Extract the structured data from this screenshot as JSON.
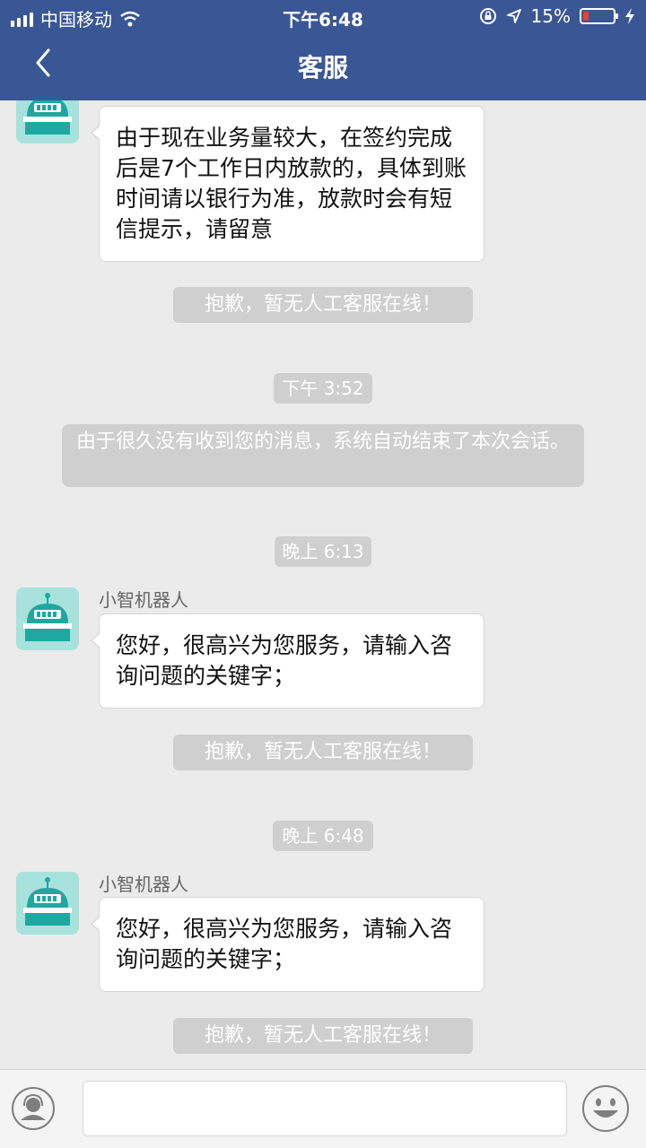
{
  "status_bar": {
    "carrier": "中国移动",
    "time": "下午6:48",
    "battery": "15%",
    "battery_level": 0.15,
    "icons": [
      "signal-icon",
      "wifi-icon",
      "orientation-lock-icon",
      "location-icon",
      "battery-icon",
      "charging-icon"
    ]
  },
  "nav": {
    "title": "客服",
    "back_icon": "chevron-left-icon"
  },
  "chat": {
    "message1_text": "由于现在业务量较大，在签约完成后是7个工作日内放款的，具体到账时间请以银行为准，放款时会有短信提示，请留意",
    "notice1": "抱歉，暂无人工客服在线！",
    "timestamp1": "下午 3:52",
    "system_message": "由于很久没有收到您的消息，系统自动结束了本次会话。",
    "timestamp2": "晚上 6:13",
    "sender2": "小智机器人",
    "message2_text": "您好，很高兴为您服务，请输入咨询问题的关键字；",
    "notice2": "抱歉，暂无人工客服在线！",
    "timestamp3": "晚上 6:48",
    "sender3": "小智机器人",
    "message3_text": "您好，很高兴为您服务，请输入咨询问题的关键字；",
    "notice3": "抱歉，暂无人工客服在线！"
  },
  "input_bar": {
    "placeholder": "",
    "left_icon": "agent-icon",
    "right_icon": "emoji-icon"
  },
  "colors": {
    "header": "#3a5795",
    "background": "#ebebeb",
    "avatar_bg": "#a7e3dc",
    "robot": "#1fa8a0",
    "notice_bg": "#cfcfcf"
  }
}
